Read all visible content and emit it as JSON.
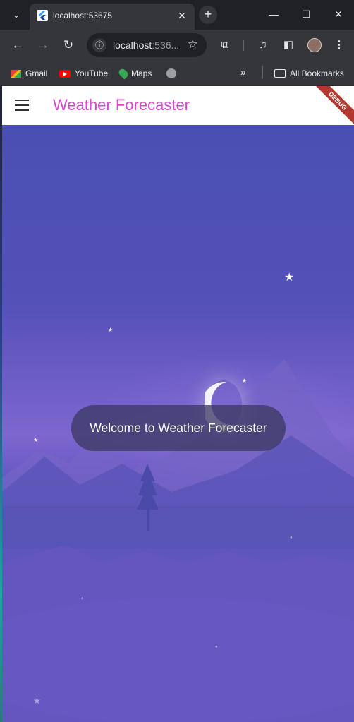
{
  "tab": {
    "title": "localhost:53675",
    "close": "✕"
  },
  "new_tab": "+",
  "window": {
    "minimize": "—",
    "maximize": "☐",
    "close": "✕"
  },
  "tab_list": "⌄",
  "nav": {
    "back": "←",
    "forward": "→",
    "reload": "↻"
  },
  "omnibox": {
    "host": "localhost",
    "rest": ":536...",
    "info": "ⓘ",
    "star": "☆"
  },
  "toolbar": {
    "extensions": "⧉",
    "media": "♫",
    "side_panel": "◧",
    "menu": "⋮"
  },
  "bookmarks": {
    "items": [
      "Gmail",
      "YouTube",
      "Maps"
    ],
    "more": "»",
    "all": "All Bookmarks"
  },
  "app": {
    "title": "Weather Forecaster",
    "debug_banner": "DEBUG",
    "toast": "Welcome to Weather Forecaster",
    "accent": "#d946d0"
  },
  "colors": {
    "sky_top": "#4a4fb3",
    "sky_mid": "#7e66cf",
    "sky_bottom": "#5e57c2"
  }
}
